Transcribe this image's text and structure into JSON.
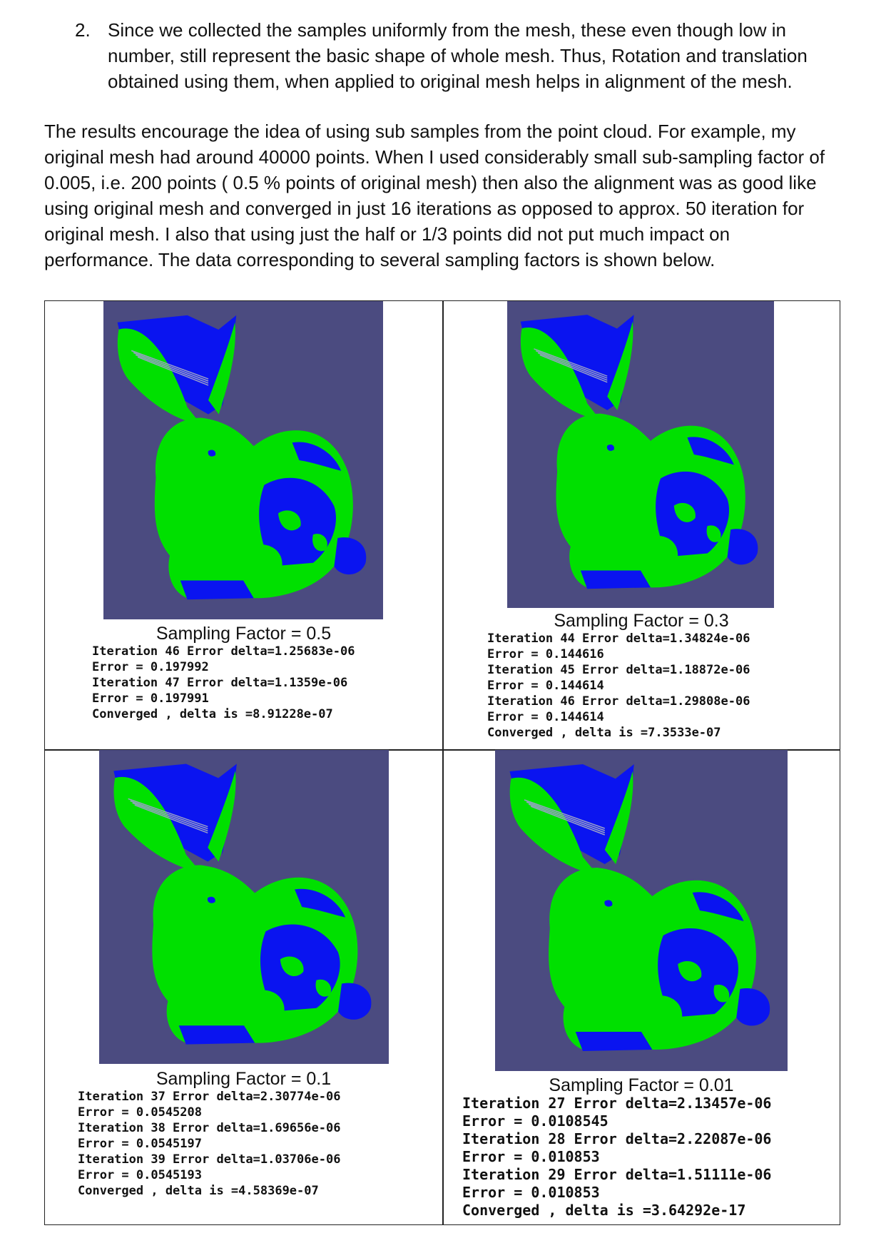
{
  "list_item": {
    "number": "2.",
    "text": "Since we collected the samples uniformly from the mesh, these even though low in number, still represent the basic shape of whole mesh. Thus, Rotation and translation obtained using them, when applied to original mesh helps in alignment of the mesh."
  },
  "paragraph": "The results encourage the idea of using sub samples from the point cloud. For example, my original mesh had around 40000 points. When I used considerably small sub-sampling factor of 0.005, i.e. 200 points ( 0.5 % points of original mesh) then also the alignment was as good like using original mesh and converged in just 16 iterations as opposed to approx. 50 iteration for original mesh. I also that using just the half or 1/3 points did not put much impact on performance. The data corresponding to several sampling factors is shown below.",
  "colors": {
    "background": "#4b4b80",
    "source_mesh": "#00e000",
    "target_mesh": "#0a14f0"
  },
  "figures": [
    {
      "caption": "Sampling Factor = 0.5",
      "log": [
        "Iteration 46 Error delta=1.25683e-06",
        "Error = 0.197992",
        "Iteration 47 Error delta=1.1359e-06",
        "Error = 0.197991",
        "Converged , delta is =8.91228e-07"
      ]
    },
    {
      "caption": "Sampling Factor = 0.3",
      "log": [
        "Iteration 44 Error delta=1.34824e-06",
        "Error = 0.144616",
        "Iteration 45 Error delta=1.18872e-06",
        "Error = 0.144614",
        "Iteration 46 Error delta=1.29808e-06",
        "Error = 0.144614",
        "Converged , delta is =7.3533e-07"
      ]
    },
    {
      "caption": "Sampling Factor = 0.1",
      "log": [
        "Iteration 37 Error delta=2.30774e-06",
        "Error = 0.0545208",
        "Iteration 38 Error delta=1.69656e-06",
        "Error = 0.0545197",
        "Iteration 39 Error delta=1.03706e-06",
        "Error = 0.0545193",
        "Converged , delta is =4.58369e-07"
      ]
    },
    {
      "caption": "Sampling Factor = 0.01",
      "log": [
        "Iteration 27 Error delta=2.13457e-06",
        "Error = 0.0108545",
        "Iteration 28 Error delta=2.22087e-06",
        "Error = 0.010853",
        "Iteration 29 Error delta=1.51111e-06",
        "Error = 0.010853",
        "Converged , delta is =3.64292e-17"
      ]
    }
  ]
}
